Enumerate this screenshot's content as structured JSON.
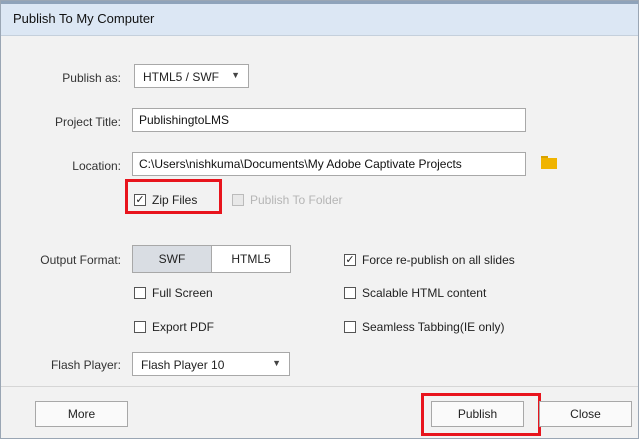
{
  "window": {
    "title": "Publish To My Computer"
  },
  "publish_as": {
    "label": "Publish as:",
    "value": "HTML5 / SWF"
  },
  "project_title": {
    "label": "Project Title:",
    "value": "PublishingtoLMS"
  },
  "location": {
    "label": "Location:",
    "value": "C:\\Users\\nishkuma\\Documents\\My Adobe Captivate Projects",
    "browse_icon": "folder-icon"
  },
  "zip_files": {
    "label": "Zip Files",
    "checked": true
  },
  "publish_to_folder": {
    "label": "Publish To Folder",
    "checked": false,
    "enabled": false
  },
  "output_format": {
    "label": "Output Format:",
    "options": [
      "SWF",
      "HTML5"
    ],
    "selected": "SWF"
  },
  "options": {
    "full_screen": {
      "label": "Full Screen",
      "checked": false
    },
    "export_pdf": {
      "label": "Export PDF",
      "checked": false
    },
    "force_republish": {
      "label": "Force re-publish on all slides",
      "checked": true
    },
    "scalable_html": {
      "label": "Scalable HTML content",
      "checked": false
    },
    "seamless_tabbing": {
      "label": "Seamless Tabbing(IE only)",
      "checked": false
    }
  },
  "flash_player": {
    "label": "Flash Player:",
    "value": "Flash Player 10"
  },
  "buttons": {
    "more": "More",
    "publish": "Publish",
    "close": "Close"
  },
  "colors": {
    "highlight": "#e8141d",
    "folder": "#f0b400",
    "titlebar": "#dce7f4"
  }
}
